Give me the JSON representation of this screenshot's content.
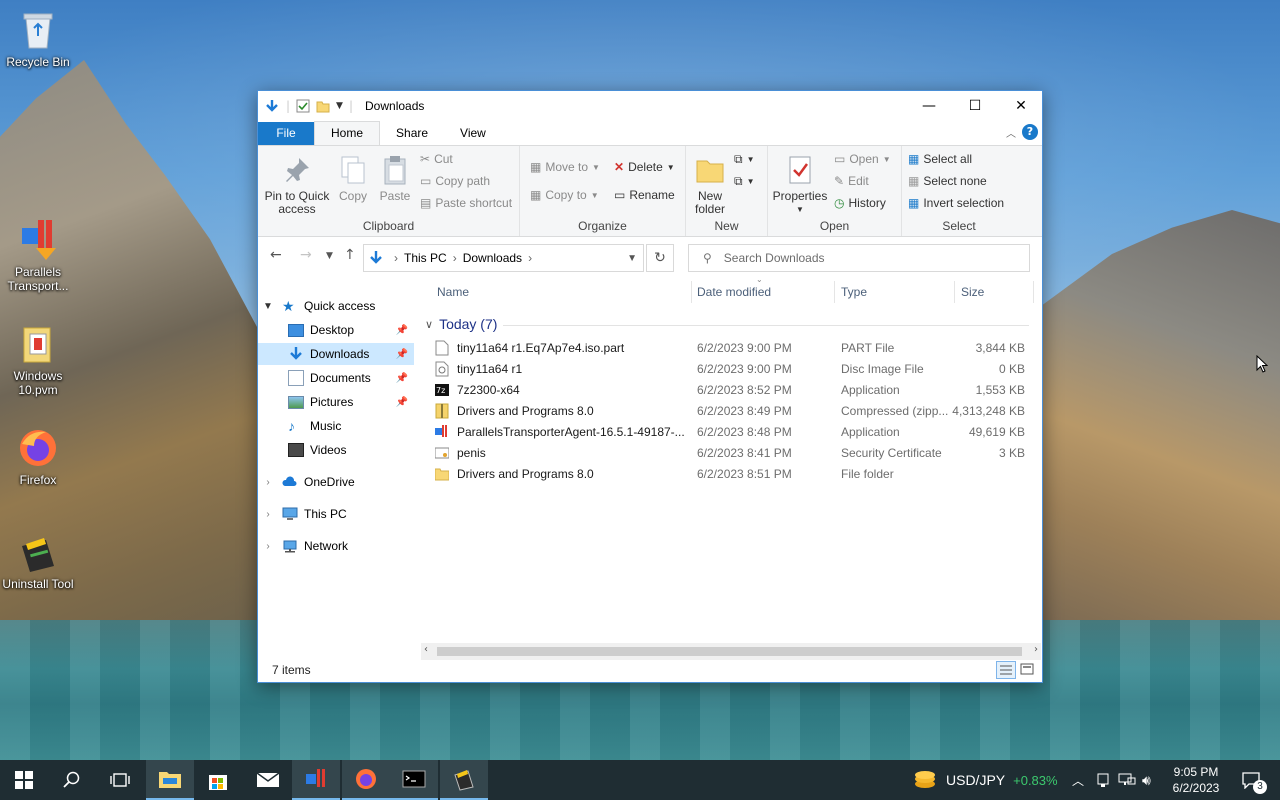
{
  "desktop": {
    "icons": [
      {
        "label": "Recycle Bin",
        "icon": "recycle-bin-icon"
      },
      {
        "label": "Parallels Transport...",
        "icon": "parallels-transporter-icon"
      },
      {
        "label": "Windows 10.pvm",
        "icon": "pvm-file-icon"
      },
      {
        "label": "Firefox",
        "icon": "firefox-icon"
      },
      {
        "label": "Uninstall Tool",
        "icon": "uninstall-tool-icon"
      }
    ]
  },
  "window": {
    "title": "Downloads",
    "tabs": {
      "file": "File",
      "home": "Home",
      "share": "Share",
      "view": "View"
    },
    "controls": {
      "minimize": "—",
      "maximize": "☐",
      "close": "✕"
    },
    "ribbon": {
      "clipboard": {
        "label": "Clipboard",
        "pin": "Pin to Quick access",
        "copy": "Copy",
        "paste": "Paste",
        "cut": "Cut",
        "copy_path": "Copy path",
        "paste_shortcut": "Paste shortcut"
      },
      "organize": {
        "label": "Organize",
        "move_to": "Move to",
        "copy_to": "Copy to",
        "delete": "Delete",
        "rename": "Rename"
      },
      "new": {
        "label": "New",
        "new_folder": "New folder"
      },
      "open": {
        "label": "Open",
        "properties": "Properties",
        "open": "Open",
        "edit": "Edit",
        "history": "History"
      },
      "select": {
        "label": "Select",
        "select_all": "Select all",
        "select_none": "Select none",
        "invert": "Invert selection"
      }
    },
    "address": {
      "crumb1": "This PC",
      "crumb2": "Downloads"
    },
    "search": {
      "placeholder": "Search Downloads"
    },
    "nav": {
      "quick_access": "Quick access",
      "desktop": "Desktop",
      "downloads": "Downloads",
      "documents": "Documents",
      "pictures": "Pictures",
      "music": "Music",
      "videos": "Videos",
      "onedrive": "OneDrive",
      "this_pc": "This PC",
      "network": "Network"
    },
    "columns": {
      "name": "Name",
      "date": "Date modified",
      "type": "Type",
      "size": "Size"
    },
    "group": "Today (7)",
    "files": [
      {
        "name": "tiny11a64 r1.Eq7Ap7e4.iso.part",
        "date": "6/2/2023 9:00 PM",
        "type": "PART File",
        "size": "3,844 KB",
        "icon": "blank-file-icon"
      },
      {
        "name": "tiny11a64 r1",
        "date": "6/2/2023 9:00 PM",
        "type": "Disc Image File",
        "size": "0 KB",
        "icon": "disc-image-icon"
      },
      {
        "name": "7z2300-x64",
        "date": "6/2/2023 8:52 PM",
        "type": "Application",
        "size": "1,553 KB",
        "icon": "7zip-icon"
      },
      {
        "name": "Drivers and Programs 8.0",
        "date": "6/2/2023 8:49 PM",
        "type": "Compressed (zipp...",
        "size": "4,313,248 KB",
        "icon": "zip-folder-icon"
      },
      {
        "name": "ParallelsTransporterAgent-16.5.1-49187-...",
        "date": "6/2/2023 8:48 PM",
        "type": "Application",
        "size": "49,619 KB",
        "icon": "parallels-app-icon"
      },
      {
        "name": "penis",
        "date": "6/2/2023 8:41 PM",
        "type": "Security Certificate",
        "size": "3 KB",
        "icon": "certificate-icon"
      },
      {
        "name": "Drivers and Programs 8.0",
        "date": "6/2/2023 8:51 PM",
        "type": "File folder",
        "size": "",
        "icon": "folder-icon"
      }
    ],
    "status": "7 items"
  },
  "taskbar": {
    "ticker_symbol": "USD/JPY",
    "ticker_change": "+0.83%",
    "time": "9:05 PM",
    "date": "6/2/2023",
    "notifications": "3"
  },
  "colors": {
    "accent": "#1979ca",
    "selected": "#cce8ff",
    "ticker_up": "#3cc96e"
  }
}
